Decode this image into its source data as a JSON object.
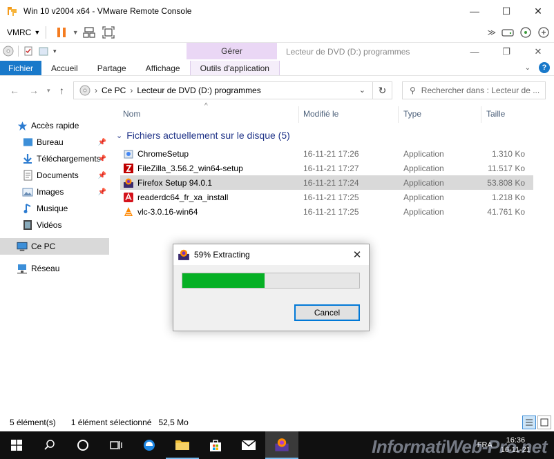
{
  "vmrc": {
    "window_title": "Win 10 v2004 x64 - VMware Remote Console",
    "menu_label": "VMRC",
    "controls": {
      "minimize": "—",
      "maximize": "☐",
      "close": "✕"
    }
  },
  "explorer": {
    "context_tab_group": "Gérer",
    "window_title": "Lecteur de DVD (D:) programmes",
    "ribbon_tabs": [
      "Fichier",
      "Accueil",
      "Partage",
      "Affichage",
      "Outils d'application"
    ],
    "address": {
      "segments": [
        "Ce PC",
        "Lecteur de DVD (D:) programmes"
      ]
    },
    "search": {
      "placeholder": "Rechercher dans : Lecteur de ..."
    },
    "sidebar": {
      "items": [
        {
          "label": "Accès rapide",
          "icon": "star-icon"
        },
        {
          "label": "Bureau",
          "icon": "desktop-folder-icon"
        },
        {
          "label": "Téléchargements",
          "icon": "download-folder-icon"
        },
        {
          "label": "Documents",
          "icon": "documents-folder-icon"
        },
        {
          "label": "Images",
          "icon": "pictures-folder-icon"
        },
        {
          "label": "Musique",
          "icon": "music-icon"
        },
        {
          "label": "Vidéos",
          "icon": "video-folder-icon"
        },
        {
          "label": "Ce PC",
          "icon": "computer-icon"
        },
        {
          "label": "Réseau",
          "icon": "network-icon"
        }
      ]
    },
    "columns": [
      "Nom",
      "Modifié le",
      "Type",
      "Taille"
    ],
    "group_header": "Fichiers actuellement sur le disque (5)",
    "files": [
      {
        "name": "ChromeSetup",
        "date": "16-11-21 17:26",
        "type": "Application",
        "size": "1.310 Ko",
        "icon": "chrome-setup-icon"
      },
      {
        "name": "FileZilla_3.56.2_win64-setup",
        "date": "16-11-21 17:27",
        "type": "Application",
        "size": "11.517 Ko",
        "icon": "filezilla-icon"
      },
      {
        "name": "Firefox Setup 94.0.1",
        "date": "16-11-21 17:24",
        "type": "Application",
        "size": "53.808 Ko",
        "icon": "firefox-setup-icon"
      },
      {
        "name": "readerdc64_fr_xa_install",
        "date": "16-11-21 17:25",
        "type": "Application",
        "size": "1.218 Ko",
        "icon": "acrobat-reader-icon"
      },
      {
        "name": "vlc-3.0.16-win64",
        "date": "16-11-21 17:25",
        "type": "Application",
        "size": "41.761 Ko",
        "icon": "vlc-icon"
      }
    ],
    "status": {
      "count": "5 élément(s)",
      "selected": "1 élément sélectionné",
      "size": "52,5 Mo"
    }
  },
  "dialog": {
    "title": "59% Extracting",
    "progress": 0.465,
    "cancel_label": "Cancel"
  },
  "taskbar": {
    "time": "16:36",
    "date": "16-11-21",
    "lang": "FRA",
    "watermark": "InformatiWeb-Pro.net"
  },
  "colors": {
    "accent": "#1979ca",
    "progress_fill": "#06b025",
    "context_tab": "#ead7f5",
    "selected_row": "#d9d9d9",
    "group_header": "#1e3287"
  }
}
